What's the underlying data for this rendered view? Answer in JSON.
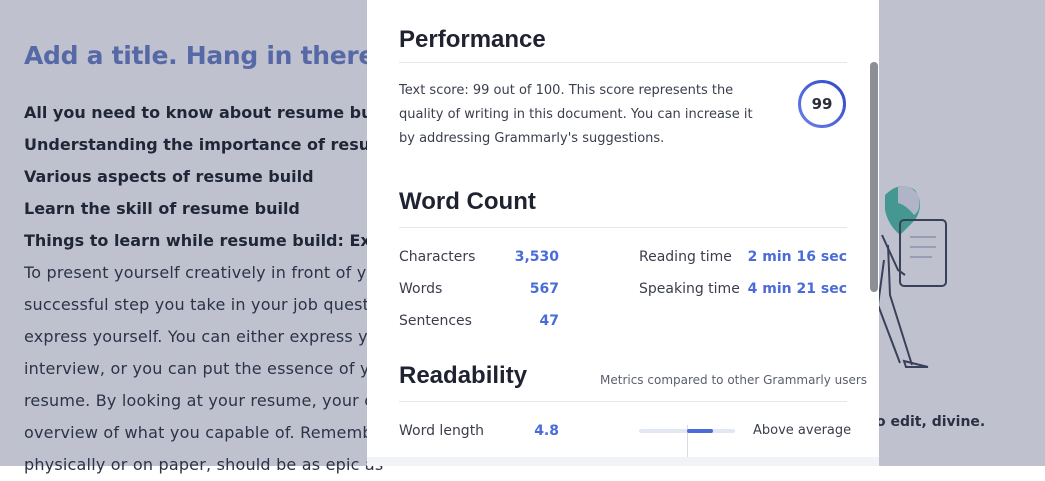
{
  "document": {
    "title": "Add a title. Hang in there!",
    "lines": [
      {
        "text": "All you need to know about resume build",
        "bold": true
      },
      {
        "text": "Understanding the importance of resume",
        "bold": true
      },
      {
        "text": "Various aspects of resume build",
        "bold": true
      },
      {
        "text": "Learn the skill of resume build",
        "bold": true
      },
      {
        "text": "Things to learn while resume build: Explai",
        "bold": true
      },
      {
        "text": "To present yourself creatively in front of yo",
        "bold": false
      },
      {
        "text": "successful step you take in your job quest.",
        "bold": false
      },
      {
        "text": "express yourself. You can either express yo",
        "bold": false
      },
      {
        "text": "interview, or you can put the essence of yo",
        "bold": false
      },
      {
        "text": "resume. By looking at your resume, your en",
        "bold": false
      },
      {
        "text": "overview of what you capable of. Remembe",
        "bold": false
      },
      {
        "text": "physically or on paper, should be as epic as",
        "bold": false
      }
    ],
    "right_caption": "o edit, divine."
  },
  "modal": {
    "performance": {
      "title": "Performance",
      "text": "Text score: 99 out of 100. This score represents the quality of writing in this document. You can increase it by addressing Grammarly's suggestions.",
      "score": "99",
      "score_fraction": 0.99
    },
    "word_count": {
      "title": "Word Count",
      "left": [
        {
          "label": "Characters",
          "value": "3,530"
        },
        {
          "label": "Words",
          "value": "567"
        },
        {
          "label": "Sentences",
          "value": "47"
        }
      ],
      "right": [
        {
          "label": "Reading time",
          "value": "2 min 16 sec"
        },
        {
          "label": "Speaking time",
          "value": "4 min 21 sec"
        }
      ]
    },
    "readability": {
      "title": "Readability",
      "note": "Metrics compared to other Grammarly users",
      "metrics": [
        {
          "label": "Word length",
          "value": "4.8",
          "comparison": "Above average"
        }
      ]
    }
  },
  "colors": {
    "accent": "#4a6bd8",
    "title_muted": "#6a7fc7",
    "overlay": "#2c365c",
    "illustration_teal": "#4fc3a8"
  }
}
